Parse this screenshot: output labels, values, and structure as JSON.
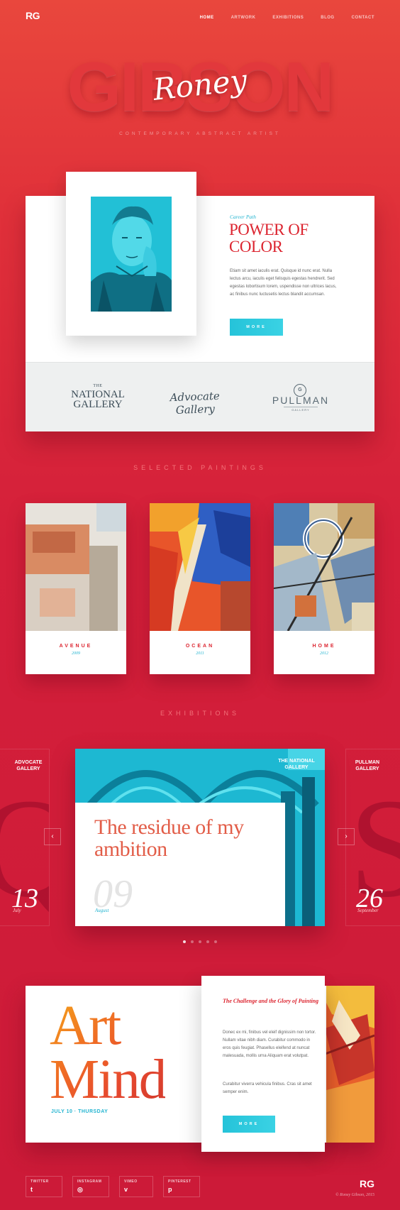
{
  "brand": {
    "logo": "RG"
  },
  "nav": {
    "items": [
      "HOME",
      "ARTWORK",
      "EXHIBITIONS",
      "BLOG",
      "CONTACT"
    ],
    "active_index": 0
  },
  "hero": {
    "surname": "GIBSON",
    "firstname": "Roney",
    "subtitle": "CONTEMPORARY ABSTRACT ARTIST"
  },
  "about": {
    "label": "Career Path",
    "title": "POWER OF COLOR",
    "text": "Etiam sit amet iaculis erat. Quisque id nunc erat. Nulla lectus arcu, iaculis eget felisquis egestas hendrerit. Sed egestas lobortisum lorem, uspendisse non ultrices lacus, ac finibus nunc luctusetis lectus blandit accumsan.",
    "button": "MORE"
  },
  "partners": {
    "national_small": "THE",
    "national": "NATIONAL GALLERY",
    "advocate": "Advocate Gallery",
    "pullman_mark": "G",
    "pullman": "PULLMAN",
    "pullman_small": "GALLERY"
  },
  "paintings": {
    "title": "SELECTED PAINTINGS",
    "items": [
      {
        "name": "AVENUE",
        "year": "2009"
      },
      {
        "name": "OCEAN",
        "year": "2011"
      },
      {
        "name": "HOME",
        "year": "2012"
      }
    ]
  },
  "exhibitions": {
    "title": "EXHIBITIONS",
    "left": {
      "venue": "ADVOCATE GALLERY",
      "letter": "Q",
      "day": "13",
      "month": "July"
    },
    "main": {
      "venue": "THE NATIONAL GALLERY",
      "title": "The residue of my ambition",
      "day": "09",
      "month": "August"
    },
    "right": {
      "venue": "PULLMAN GALLERY",
      "letter": "S",
      "day": "26",
      "month": "September"
    },
    "prev": "‹",
    "next": "›",
    "dot_count": 5,
    "active_dot": 0
  },
  "artmind": {
    "title_line1": "Art",
    "title_line2": "Mind",
    "date": "JULY 10 · THURSDAY",
    "panel_title": "The Challenge and the Glory of Painting",
    "panel_text1": "Donec ex mi, finibus vel eleif dignissim non tortor. Nullam vitae nibh diam. Curabitur commodo in eros quis feugiat. Phasellus eleifend at nuncat malesuada, mollis urna Aliquam erat volutpat.",
    "panel_text2": "Curabitur viverra vehicula finibus. Cras sit amet semper enim.",
    "button": "MORE"
  },
  "footer": {
    "social": [
      {
        "label": "TWITTER",
        "icon": "twitter-icon",
        "glyph": "t"
      },
      {
        "label": "INSTAGRAM",
        "icon": "instagram-icon",
        "glyph": "◎"
      },
      {
        "label": "VIMEO",
        "icon": "vimeo-icon",
        "glyph": "v"
      },
      {
        "label": "PINTEREST",
        "icon": "pinterest-icon",
        "glyph": "p"
      }
    ],
    "logo": "RG",
    "copyright": "© Roney Gibson, 2015"
  },
  "colors": {
    "primary": "#dc2530",
    "accent": "#23b4d0",
    "background": "#d41f3a"
  }
}
